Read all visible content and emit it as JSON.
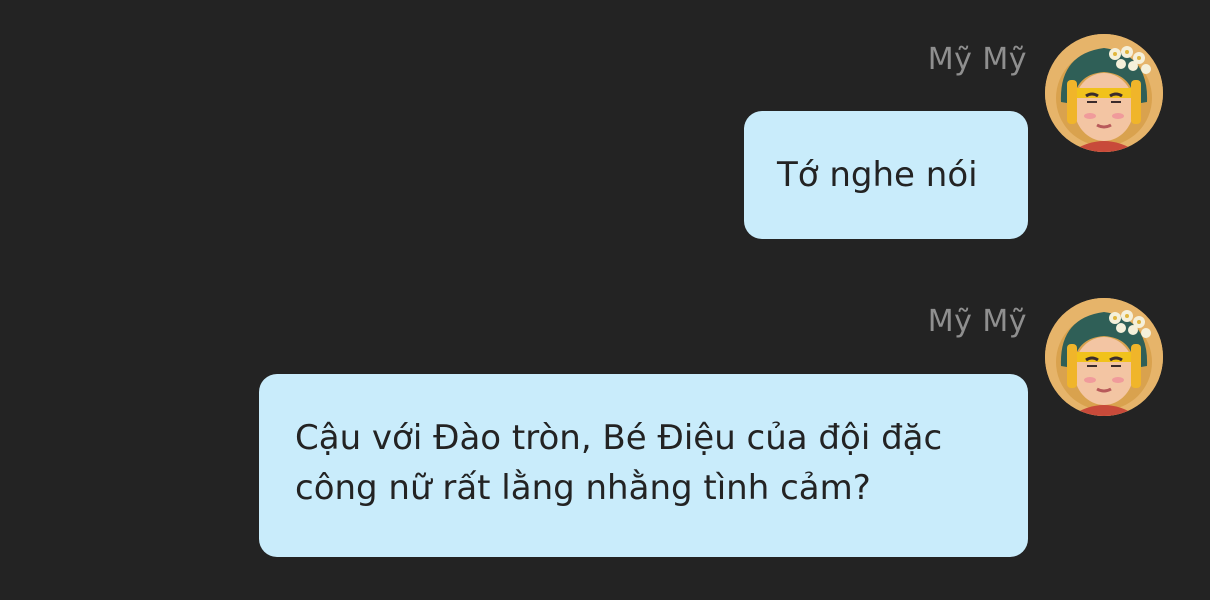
{
  "messages": [
    {
      "sender": "Mỹ Mỹ",
      "text": "Tớ nghe nói",
      "avatar_icon": "girl-avatar-icon"
    },
    {
      "sender": "Mỹ Mỹ",
      "text": "Cậu với Đào tròn, Bé Điệu của đội đặc công nữ rất lằng nhằng tình cảm?",
      "avatar_icon": "girl-avatar-icon"
    }
  ],
  "colors": {
    "background": "#232323",
    "bubble": "#c9ecfb",
    "sender_text": "#8f8f8f",
    "message_text": "#232323"
  }
}
